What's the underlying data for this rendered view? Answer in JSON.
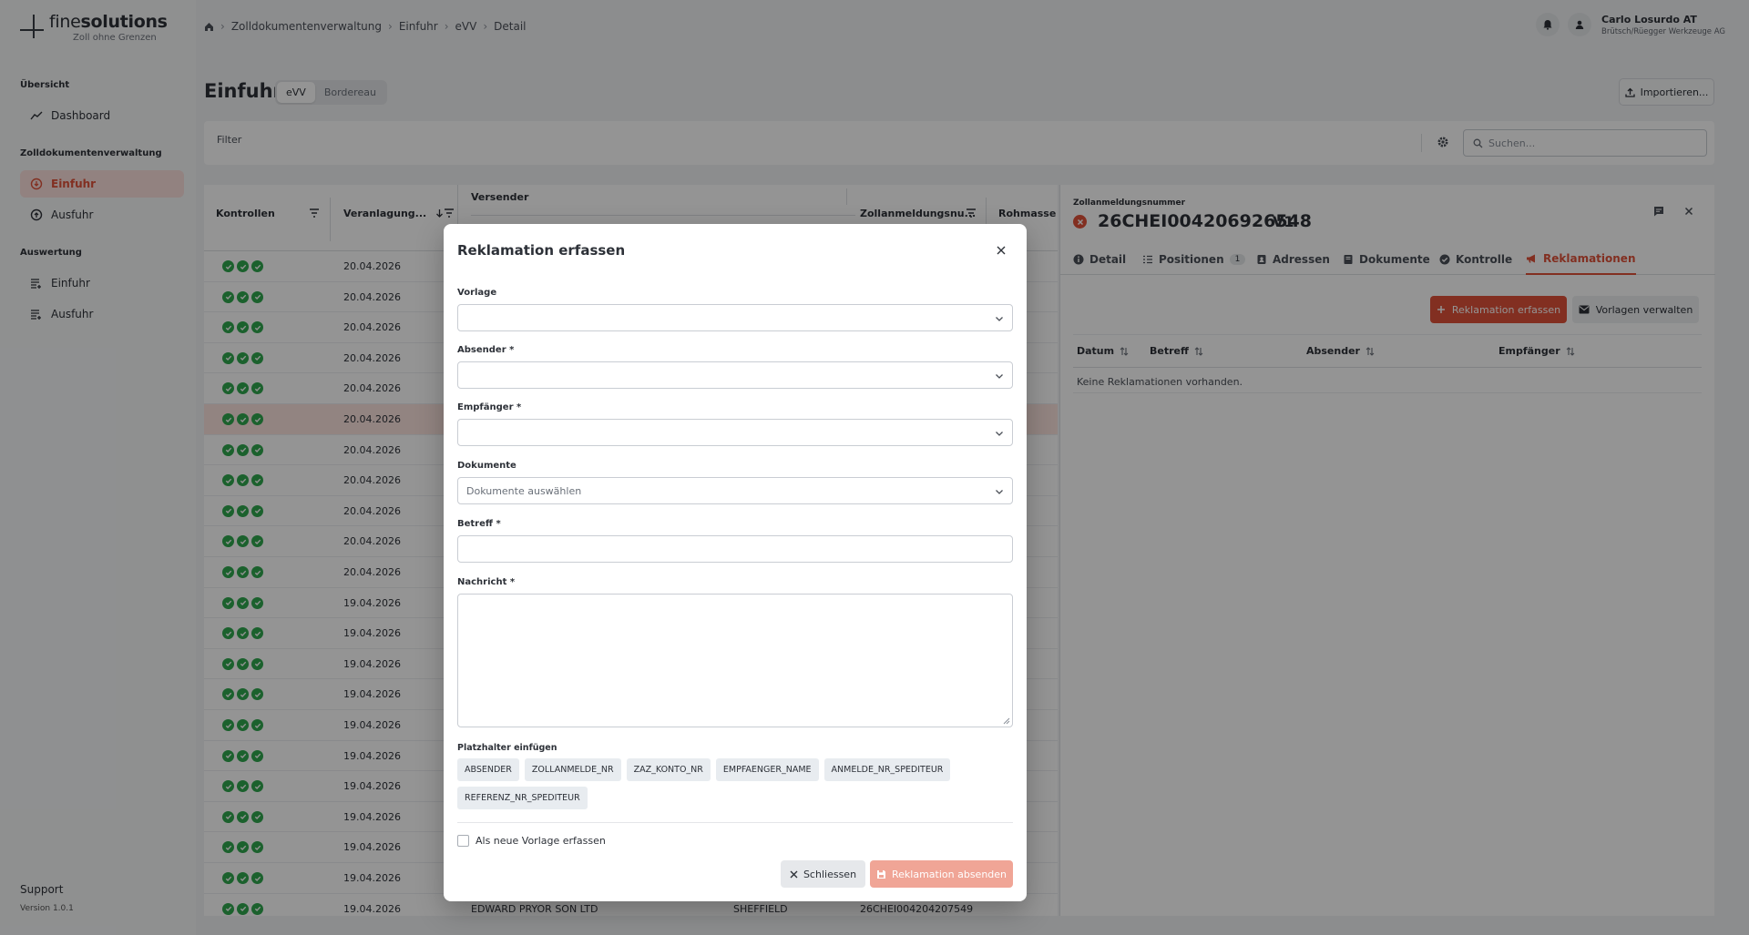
{
  "app": {
    "brand_light": "fine",
    "brand_bold": "solutions",
    "tagline": "Zoll ohne Grenzen"
  },
  "sidebar": {
    "sections": [
      {
        "title": "Übersicht",
        "items": [
          {
            "label": "Dashboard",
            "icon": "trend-icon"
          }
        ]
      },
      {
        "title": "Zolldokumentenverwaltung",
        "items": [
          {
            "label": "Einfuhr",
            "icon": "import-icon",
            "active": true
          },
          {
            "label": "Ausfuhr",
            "icon": "export-icon"
          }
        ]
      },
      {
        "title": "Auswertung",
        "items": [
          {
            "label": "Einfuhr",
            "icon": "report-icon"
          },
          {
            "label": "Ausfuhr",
            "icon": "report-icon"
          }
        ]
      }
    ],
    "support": "Support",
    "version": "Version 1.0.1"
  },
  "breadcrumb": [
    "Zolldokumentenverwaltung",
    "Einfuhr",
    "eVV",
    "Detail"
  ],
  "user": {
    "name": "Carlo Losurdo AT",
    "org": "Brütsch/Rüegger Werkzeuge AG"
  },
  "page": {
    "title": "Einfuhr",
    "segments": [
      "eVV",
      "Bordereau"
    ],
    "active_segment": "eVV",
    "import_label": "Importieren..."
  },
  "filter": {
    "label": "Filter",
    "search_placeholder": "Suchen..."
  },
  "table": {
    "columns": [
      "Kontrollen",
      "Veranlagung...",
      "Versender",
      "Zollanmeldungsnu...",
      "Rohmasse"
    ],
    "rows": [
      {
        "date": "20.04.2026"
      },
      {
        "date": "20.04.2026"
      },
      {
        "date": "20.04.2026"
      },
      {
        "date": "20.04.2026"
      },
      {
        "date": "20.04.2026"
      },
      {
        "date": "20.04.2026",
        "selected": true
      },
      {
        "date": "20.04.2026"
      },
      {
        "date": "20.04.2026"
      },
      {
        "date": "20.04.2026"
      },
      {
        "date": "20.04.2026"
      },
      {
        "date": "20.04.2026"
      },
      {
        "date": "19.04.2026"
      },
      {
        "date": "19.04.2026"
      },
      {
        "date": "19.04.2026"
      },
      {
        "date": "19.04.2026"
      },
      {
        "date": "19.04.2026"
      },
      {
        "date": "19.04.2026"
      },
      {
        "date": "19.04.2026"
      },
      {
        "date": "19.04.2026"
      },
      {
        "date": "19.04.2026"
      },
      {
        "date": "19.04.2026"
      },
      {
        "date": "19.04.2026",
        "sender": "EDWARD PRYOR SON LTD",
        "city": "SHEFFIELD",
        "declaration": "26CHEI004204207549"
      }
    ]
  },
  "detail": {
    "label": "Zollanmeldungsnummer",
    "number": "26CHEI004206926548",
    "version": "V1",
    "tabs": [
      {
        "label": "Detail"
      },
      {
        "label": "Positionen",
        "badge": "1"
      },
      {
        "label": "Adressen"
      },
      {
        "label": "Dokumente"
      },
      {
        "label": "Kontrolle"
      },
      {
        "label": "Reklamationen",
        "active": true
      }
    ],
    "add_label": "Reklamation erfassen",
    "templates_label": "Vorlagen verwalten",
    "columns": [
      "Datum",
      "Betreff",
      "Absender",
      "Empfänger"
    ],
    "empty": "Keine Reklamationen vorhanden."
  },
  "modal": {
    "title": "Reklamation erfassen",
    "fields": {
      "vorlage": "Vorlage",
      "absender": "Absender *",
      "empfaenger": "Empfänger *",
      "dokumente": "Dokumente",
      "dokumente_placeholder": "Dokumente auswählen",
      "betreff": "Betreff *",
      "nachricht": "Nachricht *"
    },
    "placeholders_label": "Platzhalter einfügen",
    "placeholders": [
      "ABSENDER",
      "ZOLLANMELDE_NR",
      "ZAZ_KONTO_NR",
      "EMPFAENGER_NAME",
      "ANMELDE_NR_SPEDITEUR",
      "REFERENZ_NR_SPEDITEUR"
    ],
    "save_template_label": "Als neue Vorlage erfassen",
    "cancel_label": "Schliessen",
    "submit_label": "Reklamation absenden"
  },
  "colors": {
    "accent": "#e0523a",
    "accent_light": "#fbe0dc",
    "check_green": "#2fa84f",
    "overlay": "rgba(0,0,0,0.42)"
  }
}
